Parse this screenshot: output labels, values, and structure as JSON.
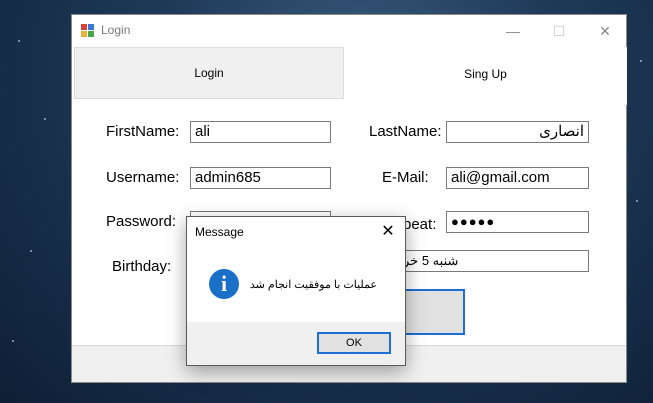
{
  "window": {
    "title": "Login",
    "icon": "app-form-icon",
    "controls": {
      "minimize": "—",
      "maximize": "☐",
      "close": "✕"
    }
  },
  "tabs": [
    {
      "label": "Login",
      "selected": false
    },
    {
      "label": "Sing Up",
      "selected": true
    }
  ],
  "form": {
    "firstname_label": "FirstName:",
    "firstname_value": "ali",
    "lastname_label": "LastName:",
    "lastname_value": "انصاری",
    "username_label": "Username:",
    "username_value": "admin685",
    "email_label": "E-Mail:",
    "email_value": "ali@gmail.com",
    "password_label": "Password:",
    "repeat_label_partial": "peat:",
    "repeat_value": "●●●●●",
    "birthday_label": "Birthday:",
    "birthday_value_partial": "شنبه 5 خر"
  },
  "dialog": {
    "title": "Message",
    "close": "✕",
    "icon": "info-icon",
    "icon_glyph": "i",
    "message": "عملیات با موفقیت انجام شد",
    "ok_label": "OK"
  },
  "colors": {
    "accent": "#1e6fd0",
    "info_icon": "#1a6fc6"
  }
}
